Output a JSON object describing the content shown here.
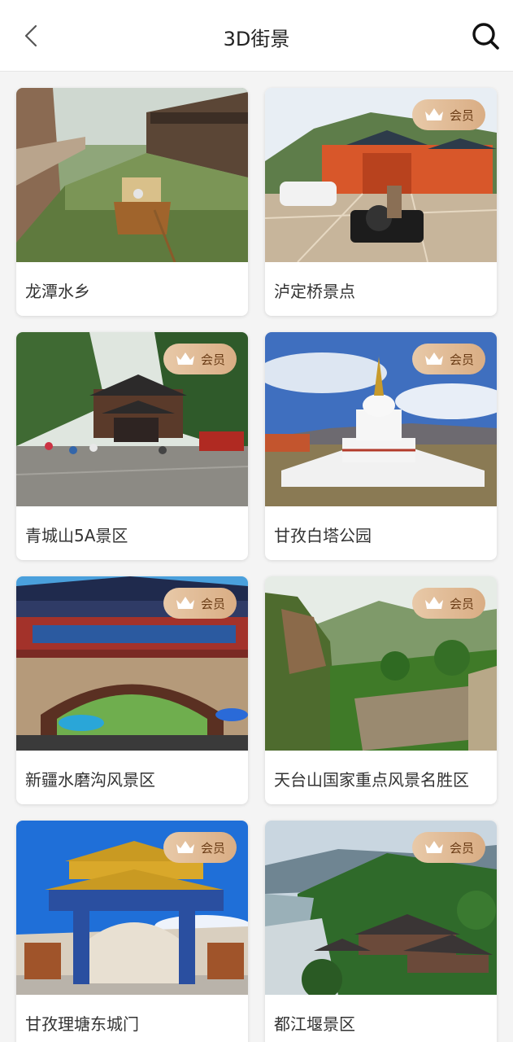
{
  "header": {
    "title": "3D街景"
  },
  "member_badge": "会员",
  "cards": [
    {
      "label": "龙潭水乡",
      "member": false,
      "scene": "canal"
    },
    {
      "label": "泸定桥景点",
      "member": true,
      "scene": "temple-square"
    },
    {
      "label": "青城山5A景区",
      "member": true,
      "scene": "mountain-temple"
    },
    {
      "label": "甘孜白塔公园",
      "member": true,
      "scene": "white-stupa"
    },
    {
      "label": "新疆水磨沟风景区",
      "member": true,
      "scene": "red-gate"
    },
    {
      "label": "天台山国家重点风景名胜区",
      "member": true,
      "scene": "cliff-valley"
    },
    {
      "label": "甘孜理塘东城门",
      "member": true,
      "scene": "tibetan-gate"
    },
    {
      "label": "都江堰景区",
      "member": true,
      "scene": "river-temple"
    }
  ]
}
